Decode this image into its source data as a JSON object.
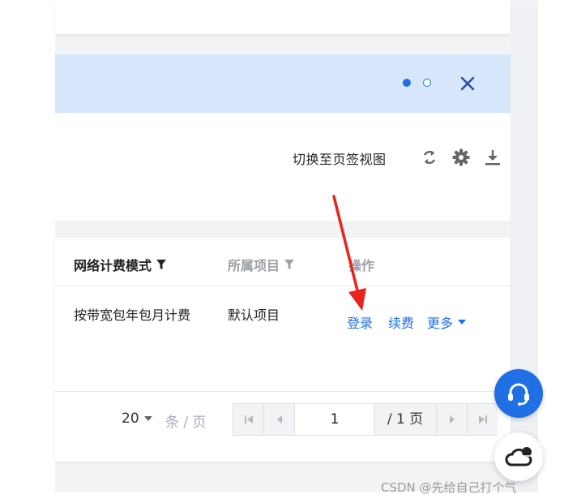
{
  "banner": {
    "slide_count": 2,
    "active_slide": 1,
    "close_icon": "close-icon",
    "accent": "#1f6fe5",
    "background": "#d6e7fb"
  },
  "toolbar": {
    "switch_view_label": "切换至页签视图",
    "icons": [
      "refresh-icon",
      "gear-icon",
      "download-icon"
    ]
  },
  "table": {
    "columns": [
      {
        "label": "网络计费模式",
        "filterable": true
      },
      {
        "label": "所属项目",
        "filterable": true
      },
      {
        "label": "操作",
        "filterable": false
      }
    ],
    "rows": [
      {
        "billing_mode": "按带宽包年包月计费",
        "project": "默认项目",
        "actions": {
          "login": "登录",
          "renew": "续费",
          "more": "更多"
        }
      }
    ]
  },
  "pagination": {
    "page_size": "20",
    "per_page_label": "条 / 页",
    "current_page": "1",
    "total_label": "/ 1 页"
  },
  "floating": {
    "support_icon": "headset-icon",
    "cloud_icon": "cloud-icon"
  },
  "annotation": {
    "arrow_color": "#e8231b"
  },
  "watermark": "CSDN @先给自己打个气"
}
